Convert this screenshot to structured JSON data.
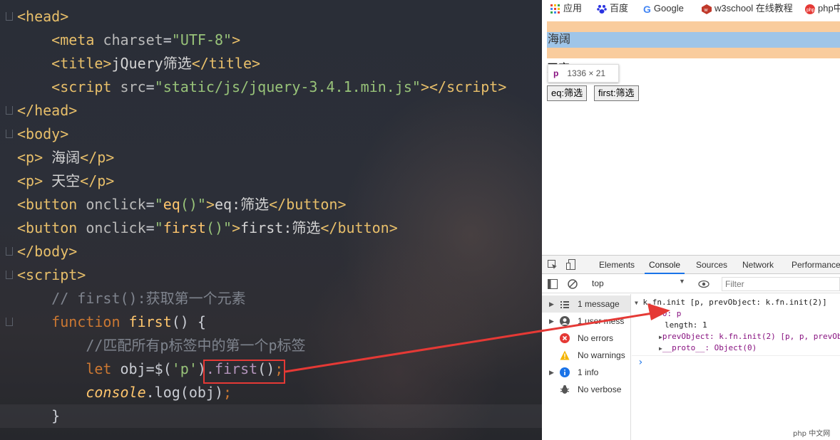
{
  "editor": {
    "lines": [
      {
        "html": "<span class='tg'>&lt;head&gt;</span>"
      },
      {
        "html": "    <span class='tg'>&lt;meta</span> <span class='at'>charset</span>=<span class='st'>\"UTF-8\"</span><span class='tg'>&gt;</span>"
      },
      {
        "html": "    <span class='tg'>&lt;title&gt;</span><span class='txt'>jQuery筛选</span><span class='tg'>&lt;/title&gt;</span>"
      },
      {
        "html": "    <span class='tg'>&lt;script</span> <span class='at'>src</span>=<span class='st'>\"static/js/jquery-3.4.1.min.js\"</span><span class='tg'>&gt;&lt;/script&gt;</span>"
      },
      {
        "html": "<span class='tg'>&lt;/head&gt;</span>"
      },
      {
        "html": "<span class='tg'>&lt;body&gt;</span>"
      },
      {
        "html": "<span class='tg'>&lt;p&gt;</span><span class='txt'> 海阔</span><span class='tg'>&lt;/p&gt;</span>"
      },
      {
        "html": "<span class='tg'>&lt;p&gt;</span><span class='txt'> 天空</span><span class='tg'>&lt;/p&gt;</span>"
      },
      {
        "html": "<span class='tg'>&lt;button</span> <span class='at'>onclick</span>=<span class='st'>\"</span><span class='fn'>eq</span><span class='st'>()\"</span><span class='tg'>&gt;</span><span class='txt'>eq:筛选</span><span class='tg'>&lt;/button&gt;</span>"
      },
      {
        "html": "<span class='tg'>&lt;button</span> <span class='at'>onclick</span>=<span class='st'>\"</span><span class='fn'>first</span><span class='st'>()\"</span><span class='tg'>&gt;</span><span class='txt'>first:筛选</span><span class='tg'>&lt;/button&gt;</span>"
      },
      {
        "html": "<span class='tg'>&lt;/body&gt;</span>"
      },
      {
        "html": "<span class='tg'>&lt;script&gt;</span>"
      },
      {
        "html": "    <span class='cm'>// first():获取第一个元素</span>"
      },
      {
        "html": "    <span class='kw'>function</span> <span class='fn'>first</span>() {"
      },
      {
        "html": "        <span class='cm'>//匹配所有p标签中的第一个p标签</span>"
      },
      {
        "html": "        <span class='kw'>let</span> obj=$(<span class='st'>'p'</span>)<span class='mt'>.first</span>()<span class='sm'>;</span>"
      },
      {
        "html": "        <span class='it'>console</span>.log(obj)<span class='sm'>;</span>"
      },
      {
        "html": "    }"
      }
    ]
  },
  "bookmarks": {
    "apps": "应用",
    "baidu": "百度",
    "google": "Google",
    "w3school": "w3school 在线教程",
    "php": "php中"
  },
  "page": {
    "p1": "海阔",
    "p2": "天空",
    "tooltip_tag": "p",
    "tooltip_size": "1336 × 21",
    "btn_eq": "eq:筛选",
    "btn_first": "first:筛选"
  },
  "devtools": {
    "tabs": [
      "Elements",
      "Console",
      "Sources",
      "Network",
      "Performance"
    ],
    "active_tab": "Console",
    "context": "top",
    "filter_placeholder": "Filter",
    "sidebar": [
      "1 message",
      "1 user mess",
      "No errors",
      "No warnings",
      "1 info",
      "No verbose"
    ],
    "console": {
      "header": "k.fn.init [p, prevObject: k.fn.init(2)]",
      "item0_key": "0: p",
      "length": "length: 1",
      "prevObject": "prevObject: k.fn.init(2) [p, p, prevOb",
      "proto": "__proto__: Object(0)",
      "prompt": "›"
    }
  },
  "watermark": "php 中文网",
  "colors": {
    "annotation_red": "#e53935",
    "devtools_accent": "#1a73e8"
  }
}
